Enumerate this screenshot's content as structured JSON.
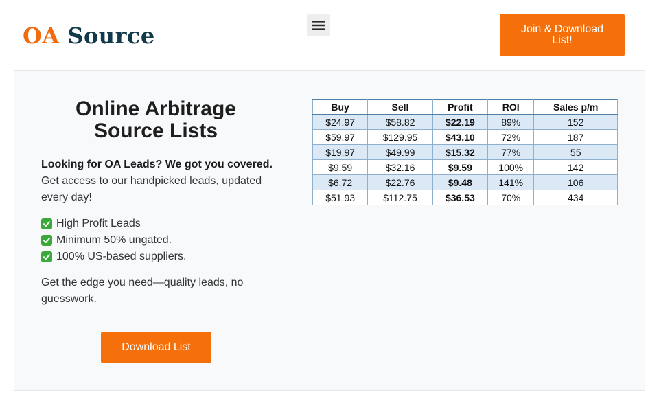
{
  "header": {
    "logo_part1": "OA",
    "logo_part2": "Source",
    "join_button": "Join & Download List!"
  },
  "hero": {
    "title": "Online Arbitrage Source Lists",
    "lead_bold": "Looking for OA Leads? We got you covered.",
    "lead_text": "Get access to our handpicked leads, updated every day!",
    "features": [
      "High Profit Leads",
      "Minimum 50% ungated.",
      "100% US-based suppliers."
    ],
    "edge_text": "Get the edge you need—quality leads, no guesswork.",
    "download_button": "Download List"
  },
  "table": {
    "headers": [
      "Buy",
      "Sell",
      "Profit",
      "ROI",
      "Sales p/m"
    ],
    "rows": [
      [
        "$24.97",
        "$58.82",
        "$22.19",
        "89%",
        "152"
      ],
      [
        "$59.97",
        "$129.95",
        "$43.10",
        "72%",
        "187"
      ],
      [
        "$19.97",
        "$49.99",
        "$15.32",
        "77%",
        "55"
      ],
      [
        "$9.59",
        "$32.16",
        "$9.59",
        "100%",
        "142"
      ],
      [
        "$6.72",
        "$22.76",
        "$9.48",
        "141%",
        "106"
      ],
      [
        "$51.93",
        "$112.75",
        "$36.53",
        "70%",
        "434"
      ]
    ]
  },
  "colors": {
    "accent": "#f56f0a",
    "logo_dark": "#123a4a",
    "check": "#3aa83a"
  }
}
